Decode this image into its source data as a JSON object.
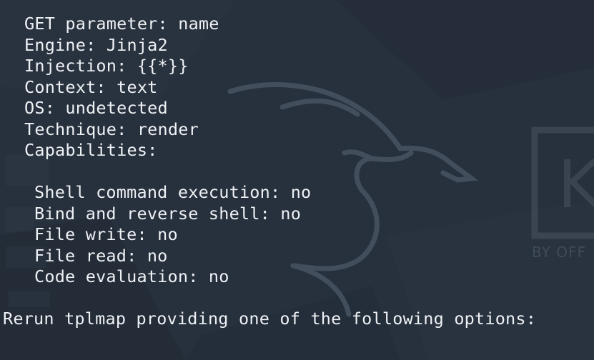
{
  "terminal": {
    "lines": [
      "GET parameter: name",
      "Engine: Jinja2",
      "Injection: {{*}}",
      "Context: text",
      "OS: undetected",
      "Technique: render",
      "Capabilities:"
    ],
    "capabilities": [
      "Shell command execution: no",
      "Bind and reverse shell: no",
      "File write: no",
      "File read: no",
      "Code evaluation: no"
    ],
    "rerun": "Rerun tplmap providing one of the following options:"
  },
  "wallpaper": {
    "logo_text": "BY OFF"
  },
  "colors": {
    "background": "#27303d",
    "text": "#eef1f4"
  }
}
